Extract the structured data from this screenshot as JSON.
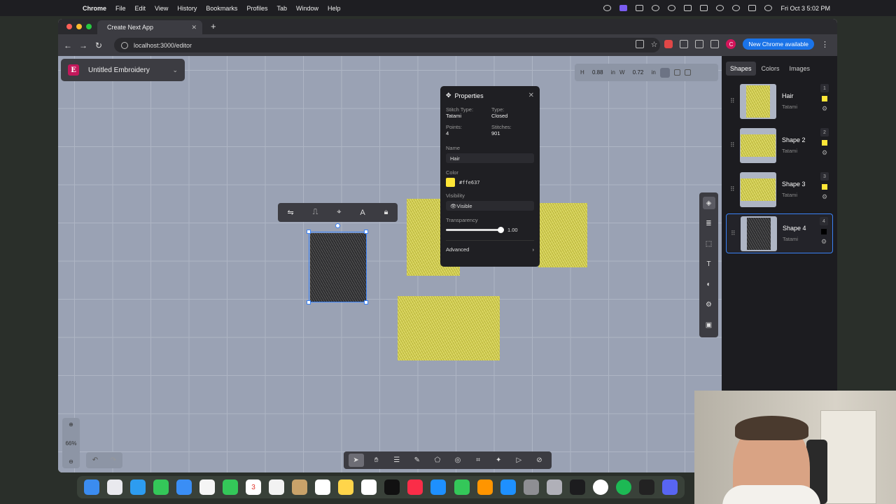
{
  "menubar": {
    "app_name": "Chrome",
    "items": [
      "File",
      "Edit",
      "View",
      "History",
      "Bookmarks",
      "Profiles",
      "Tab",
      "Window",
      "Help"
    ],
    "clock": "Fri Oct 3  5:02 PM"
  },
  "browser": {
    "tab_title": "Create Next App",
    "url": "localhost:3000/editor",
    "profile_initial": "C",
    "update_label": "New Chrome available"
  },
  "app": {
    "doc_logo": "E",
    "doc_title": "Untitled Embroidery",
    "dims": {
      "h_label": "H",
      "h_value": "0.88",
      "h_unit": "in",
      "w_label": "W",
      "w_value": "0.72",
      "w_unit": "in"
    },
    "zoom_level": "66%",
    "properties": {
      "title": "Properties",
      "stitch_type_label": "Stitch Type:",
      "stitch_type": "Tatami",
      "type_label": "Type:",
      "type": "Closed",
      "points_label": "Points:",
      "points": "4",
      "stitches_label": "Stitches:",
      "stitches": "901",
      "name_label": "Name",
      "name": "Hair",
      "color_label": "Color",
      "color": "#ffe637",
      "visibility_label": "Visibility",
      "visibility": "Visible",
      "transparency_label": "Transparency",
      "transparency": "1.00",
      "advanced_label": "Advanced"
    },
    "sidebar": {
      "tabs": [
        "Shapes",
        "Colors",
        "Images"
      ],
      "layers": [
        {
          "num": "1",
          "name": "Hair",
          "stitch": "Tatami",
          "color": "#ffe637"
        },
        {
          "num": "2",
          "name": "Shape 2",
          "stitch": "Tatami",
          "color": "#ffe637"
        },
        {
          "num": "3",
          "name": "Shape 3",
          "stitch": "Tatami",
          "color": "#ffe637"
        },
        {
          "num": "4",
          "name": "Shape 4",
          "stitch": "Tatami",
          "color": "#000000"
        }
      ]
    }
  },
  "dock": {
    "calendar_day": "3"
  }
}
